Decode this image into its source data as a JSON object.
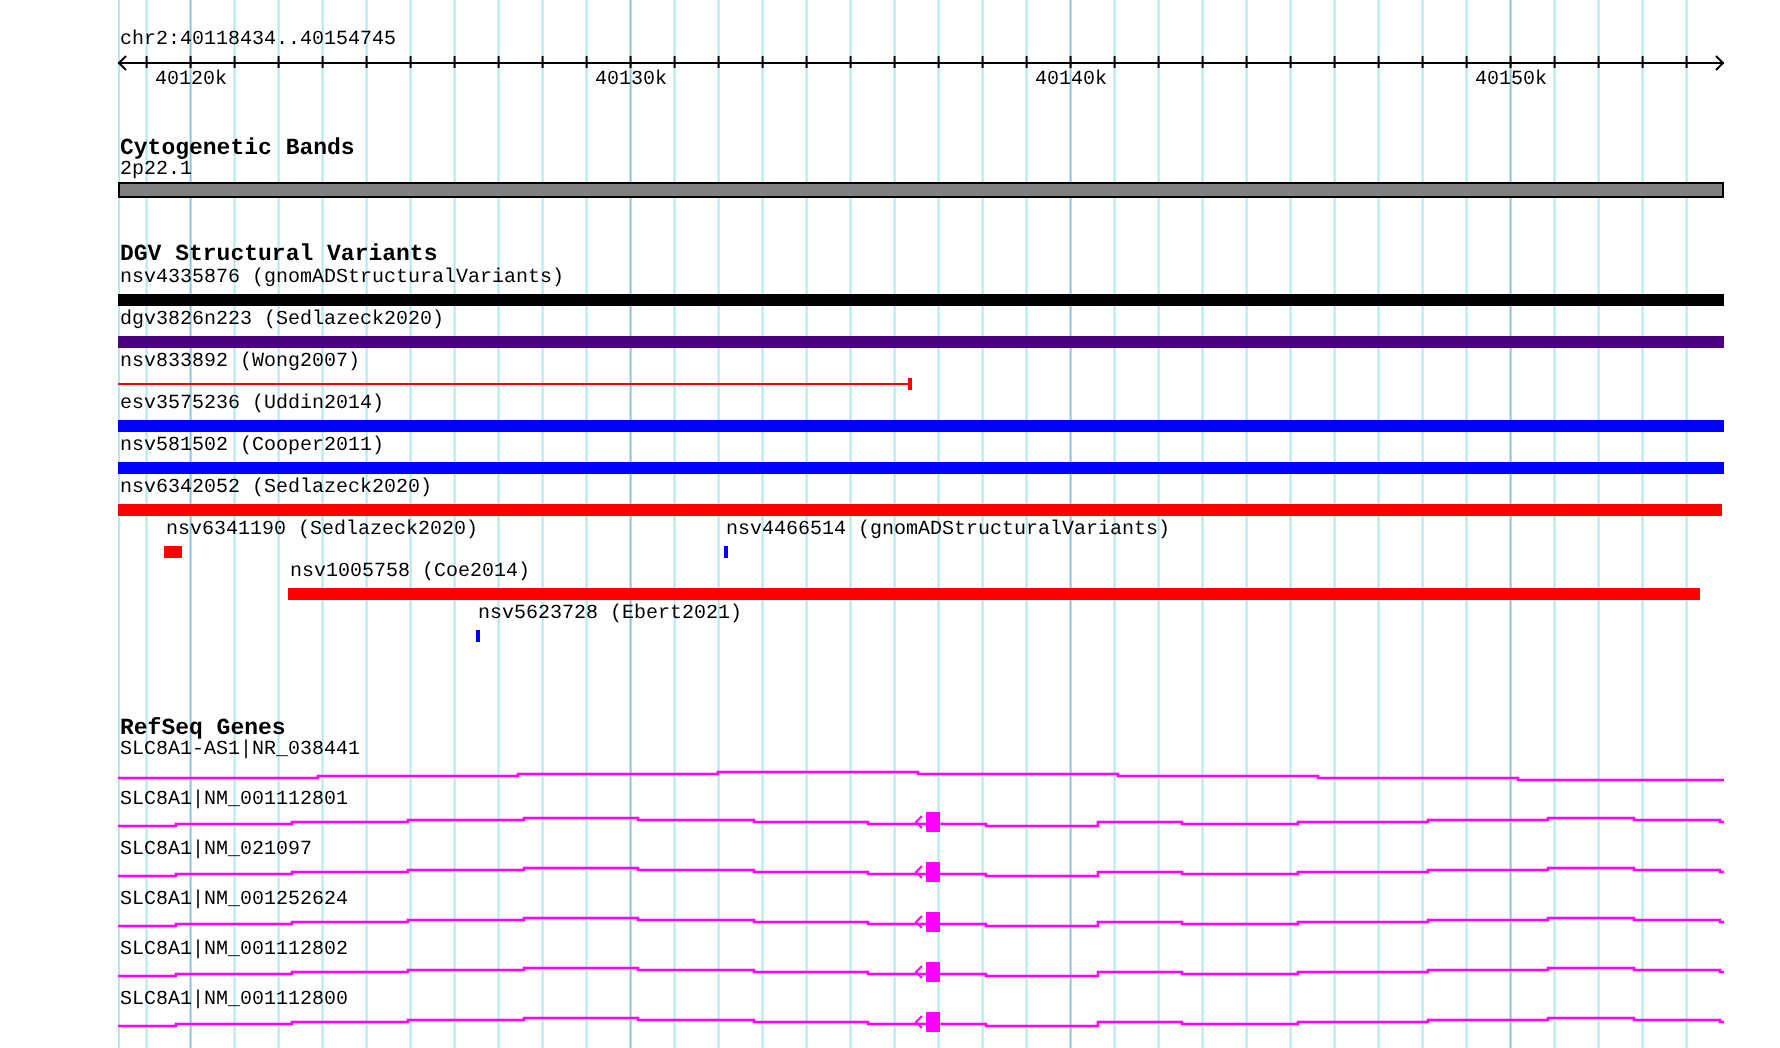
{
  "ruler": {
    "location": "chr2:40118434..40154745",
    "ticks": [
      "40120k",
      "40130k",
      "40140k",
      "40150k"
    ]
  },
  "tracks": [
    {
      "kind": "bands",
      "title": "Cytogenetic Bands",
      "features": [
        {
          "label": "2p22.1",
          "color": "#808080"
        }
      ]
    },
    {
      "kind": "variants",
      "title": "DGV Structural Variants",
      "features": [
        {
          "label": "nsv4335876 (gnomADStructuralVariants)",
          "color": "#000000",
          "kind": "bar"
        },
        {
          "label": "dgv3826n223 (Sedlazeck2020)",
          "color": "#4b0082",
          "kind": "bar"
        },
        {
          "label": "nsv833892 (Wong2007)",
          "color": "#ff0000",
          "kind": "line"
        },
        {
          "label": "esv3575236 (Uddin2014)",
          "color": "#0000ff",
          "kind": "bar"
        },
        {
          "label": "nsv581502 (Cooper2011)",
          "color": "#0000ff",
          "kind": "bar"
        },
        {
          "label": "nsv6342052 (Sedlazeck2020)",
          "color": "#ff0000",
          "kind": "bar"
        },
        {
          "label": "nsv6341190 (Sedlazeck2020)",
          "color": "#ff0000",
          "kind": "bar"
        },
        {
          "label": "nsv4466514 (gnomADStructuralVariants)",
          "color": "#0000ff",
          "kind": "bar"
        },
        {
          "label": "nsv1005758 (Coe2014)",
          "color": "#ff0000",
          "kind": "bar"
        },
        {
          "label": "nsv5623728 (Ebert2021)",
          "color": "#0000ff",
          "kind": "bar"
        }
      ]
    },
    {
      "kind": "genes",
      "title": "RefSeq Genes",
      "features": [
        {
          "label": "SLC8A1-AS1|NR_038441",
          "color": "#ff00ff",
          "kind": "noncoding"
        },
        {
          "label": "SLC8A1|NM_001112801",
          "color": "#ff00ff",
          "kind": "coding"
        },
        {
          "label": "SLC8A1|NM_021097",
          "color": "#ff00ff",
          "kind": "coding"
        },
        {
          "label": "SLC8A1|NM_001252624",
          "color": "#ff00ff",
          "kind": "coding"
        },
        {
          "label": "SLC8A1|NM_001112802",
          "color": "#ff00ff",
          "kind": "coding"
        },
        {
          "label": "SLC8A1|NM_001112800",
          "color": "#ff00ff",
          "kind": "coding"
        }
      ]
    }
  ]
}
